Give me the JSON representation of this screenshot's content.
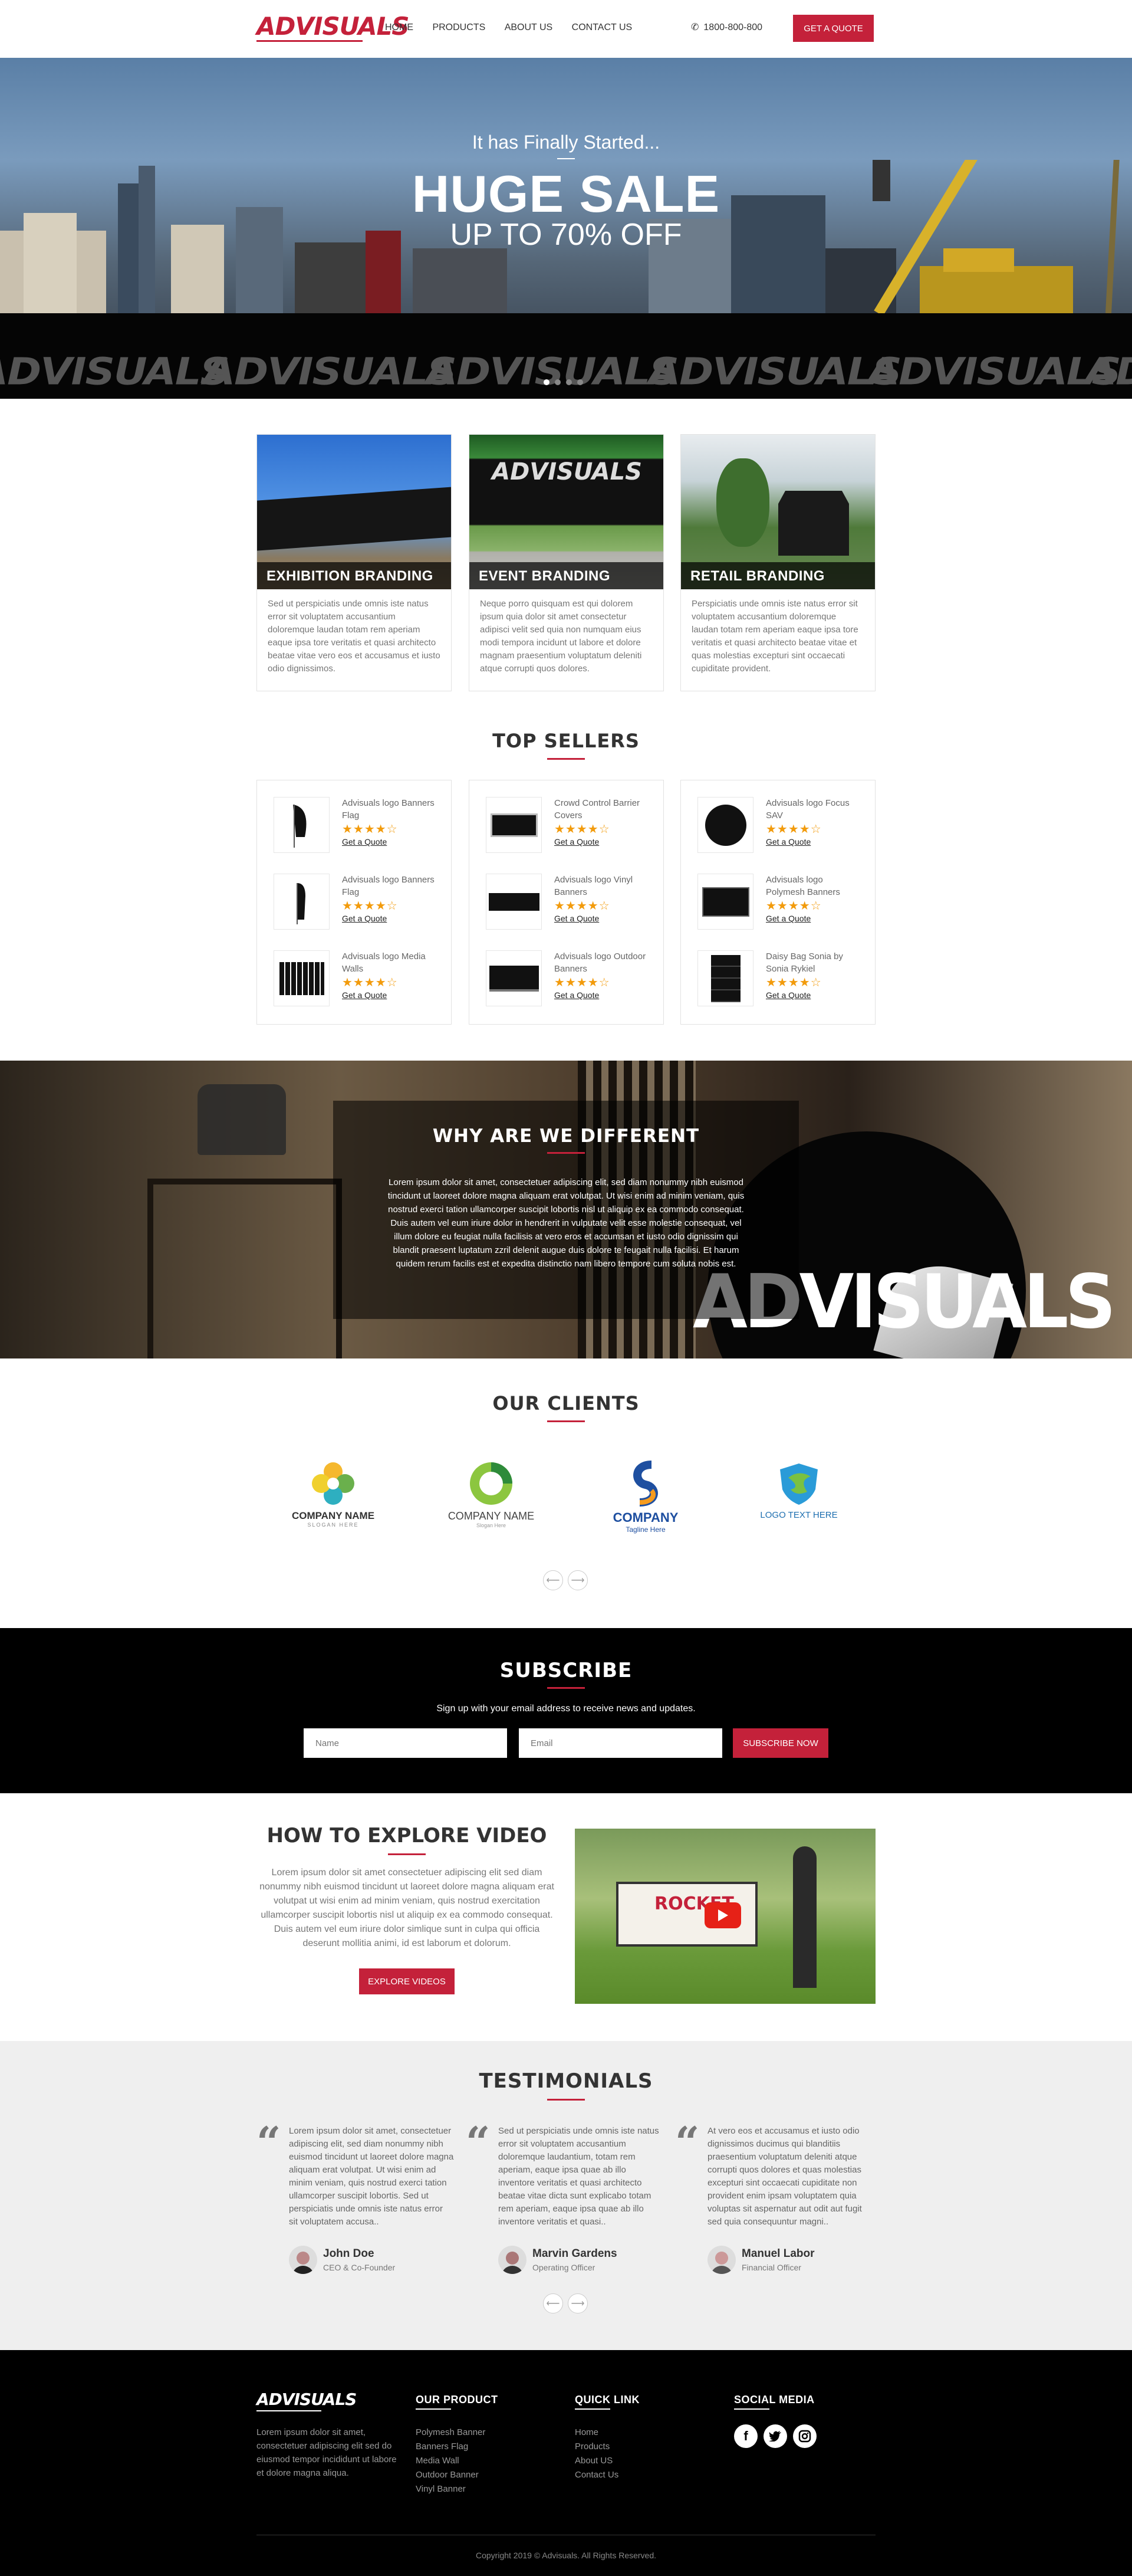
{
  "header": {
    "logo": "ADVISUALS",
    "nav": [
      "HOME",
      "PRODUCTS",
      "ABOUT US",
      "CONTACT US"
    ],
    "phone": "1800-800-800",
    "cta": "GET A QUOTE"
  },
  "hero": {
    "kicker": "It has Finally Started...",
    "title": "HUGE SALE",
    "subtitle": "UP TO 70% OFF",
    "band_text": "ADVISUALS",
    "slide_dots": 4,
    "active_dot": 1
  },
  "categories": [
    {
      "title": "EXHIBITION BRANDING",
      "text": "Sed ut perspiciatis unde omnis iste natus error sit voluptatem accusantium doloremque laudan totam rem aperiam eaque ipsa tore veritatis et quasi architecto beatae vitae vero eos et accusamus et iusto odio dignissimos."
    },
    {
      "title": "EVENT BRANDING",
      "text": "Neque porro quisquam est qui dolorem ipsum quia dolor sit amet consectetur adipisci velit sed quia non numquam eius modi tempora incidunt ut labore et dolore magnam praesentium voluptatum deleniti atque corrupti quos dolores."
    },
    {
      "title": "RETAIL BRANDING",
      "text": "Perspiciatis unde omnis iste natus error sit voluptatem accusantium doloremque laudan totam rem aperiam eaque ipsa tore veritatis et quasi architecto beatae vitae et quas molestias excepturi sint occaecati cupiditate provident."
    }
  ],
  "top_sellers": {
    "title": "TOP SELLERS",
    "quote_label": "Get a Quote",
    "stars": "★★★★☆",
    "rating": 4,
    "columns": [
      [
        {
          "name": "Advisuals logo Banners Flag"
        },
        {
          "name": "Advisuals logo Banners Flag"
        },
        {
          "name": "Advisuals logo Media Walls"
        }
      ],
      [
        {
          "name": "Crowd Control Barrier Covers"
        },
        {
          "name": "Advisuals logo Vinyl Banners"
        },
        {
          "name": "Advisuals logo Outdoor Banners"
        }
      ],
      [
        {
          "name": "Advisuals logo Focus SAV"
        },
        {
          "name": "Advisuals logo Polymesh Banners"
        },
        {
          "name": "Daisy Bag Sonia by Sonia Rykiel"
        }
      ]
    ]
  },
  "why": {
    "title": "WHY ARE WE DIFFERENT",
    "text": "Lorem ipsum dolor sit amet, consectetuer adipiscing elit, sed diam nonummy nibh euismod tincidunt ut laoreet dolore magna aliquam erat volutpat. Ut wisi enim ad minim veniam, quis nostrud exerci tation ullamcorper suscipit lobortis nisl ut aliquip ex ea commodo consequat. Duis autem vel eum iriure dolor in hendrerit in vulputate velit esse molestie consequat, vel illum dolore eu feugiat nulla facilisis at vero eros et accumsan et iusto odio dignissim qui blandit praesent luptatum zzril delenit augue duis dolore te feugait nulla facilisi. Et harum quidem rerum facilis est et expedita distinctio nam libero tempore cum soluta nobis est.",
    "sign": "ADVISUALS"
  },
  "clients": {
    "title": "OUR CLIENTS",
    "logos": [
      {
        "name": "COMPANY NAME",
        "tag": "SLOGAN HERE"
      },
      {
        "name": "COMPANY NAME",
        "tag": "Slogan Here"
      },
      {
        "name": "COMPANY",
        "tag": "Tagline Here"
      },
      {
        "name": "LOGO TEXT HERE",
        "tag": ""
      }
    ],
    "prev": "⟵",
    "next": "⟶"
  },
  "subscribe": {
    "title": "SUBSCRIBE",
    "text": "Sign up with your email address to receive news and updates.",
    "name_ph": "Name",
    "email_ph": "Email",
    "button": "SUBSCRIBE NOW"
  },
  "video": {
    "title": "HOW TO EXPLORE VIDEO",
    "text": "Lorem ipsum dolor sit amet consectetuer adipiscing elit sed diam nonummy nibh euismod tincidunt ut laoreet dolore magna aliquam erat volutpat ut wisi enim ad minim veniam, quis nostrud exercitation ullamcorper suscipit lobortis nisl ut aliquip ex ea commodo consequat. Duis autem vel eum iriure dolor simlique sunt in culpa qui officia deserunt mollitia animi, id est laborum et dolorum.",
    "button": "EXPLORE VIDEOS",
    "banner_text": "ROCKET"
  },
  "testimonials": {
    "title": "TESTIMONIALS",
    "items": [
      {
        "text": "Lorem ipsum dolor sit amet, consectetuer adipiscing elit, sed diam nonummy nibh euismod tincidunt ut laoreet dolore magna aliquam erat volutpat. Ut wisi enim ad minim veniam, quis nostrud exerci tation ullamcorper suscipit lobortis. Sed ut perspiciatis unde omnis iste natus error sit voluptatem accusa..",
        "name": "John Doe",
        "role": "CEO & Co-Founder"
      },
      {
        "text": "Sed ut perspiciatis unde omnis iste natus error sit voluptatem accusantium doloremque laudantium, totam rem aperiam, eaque ipsa quae ab illo inventore veritatis et quasi architecto beatae vitae dicta sunt explicabo totam rem aperiam, eaque ipsa quae ab illo inventore veritatis et quasi..",
        "name": "Marvin Gardens",
        "role": "Operating Officer"
      },
      {
        "text": "At vero eos et accusamus et iusto odio dignissimos ducimus qui blanditiis praesentium voluptatum deleniti atque corrupti quos dolores et quas molestias excepturi sint occaecati cupiditate non provident enim ipsam voluptatem quia voluptas sit aspernatur aut odit aut fugit sed quia consequuntur magni..",
        "name": "Manuel Labor",
        "role": "Financial Officer"
      }
    ],
    "prev": "⟵",
    "next": "⟶"
  },
  "footer": {
    "logo": "ADVISUALS",
    "about": "Lorem ipsum dolor sit amet, consectetuer adipiscing elit sed do eiusmod tempor incididunt ut labore et dolore magna aliqua.",
    "product_title": "OUR PRODUCT",
    "products": [
      "Polymesh Banner",
      "Banners Flag",
      "Media Wall",
      "Outdoor Banner",
      "Vinyl Banner"
    ],
    "links_title": "QUICK LINK",
    "links": [
      "Home",
      "Products",
      "About US",
      "Contact Us"
    ],
    "social_title": "SOCIAL MEDIA",
    "social": [
      "facebook-icon",
      "twitter-icon",
      "instagram-icon"
    ],
    "copyright": "Copyright 2019 © Advisuals. All Rights Reserved."
  }
}
